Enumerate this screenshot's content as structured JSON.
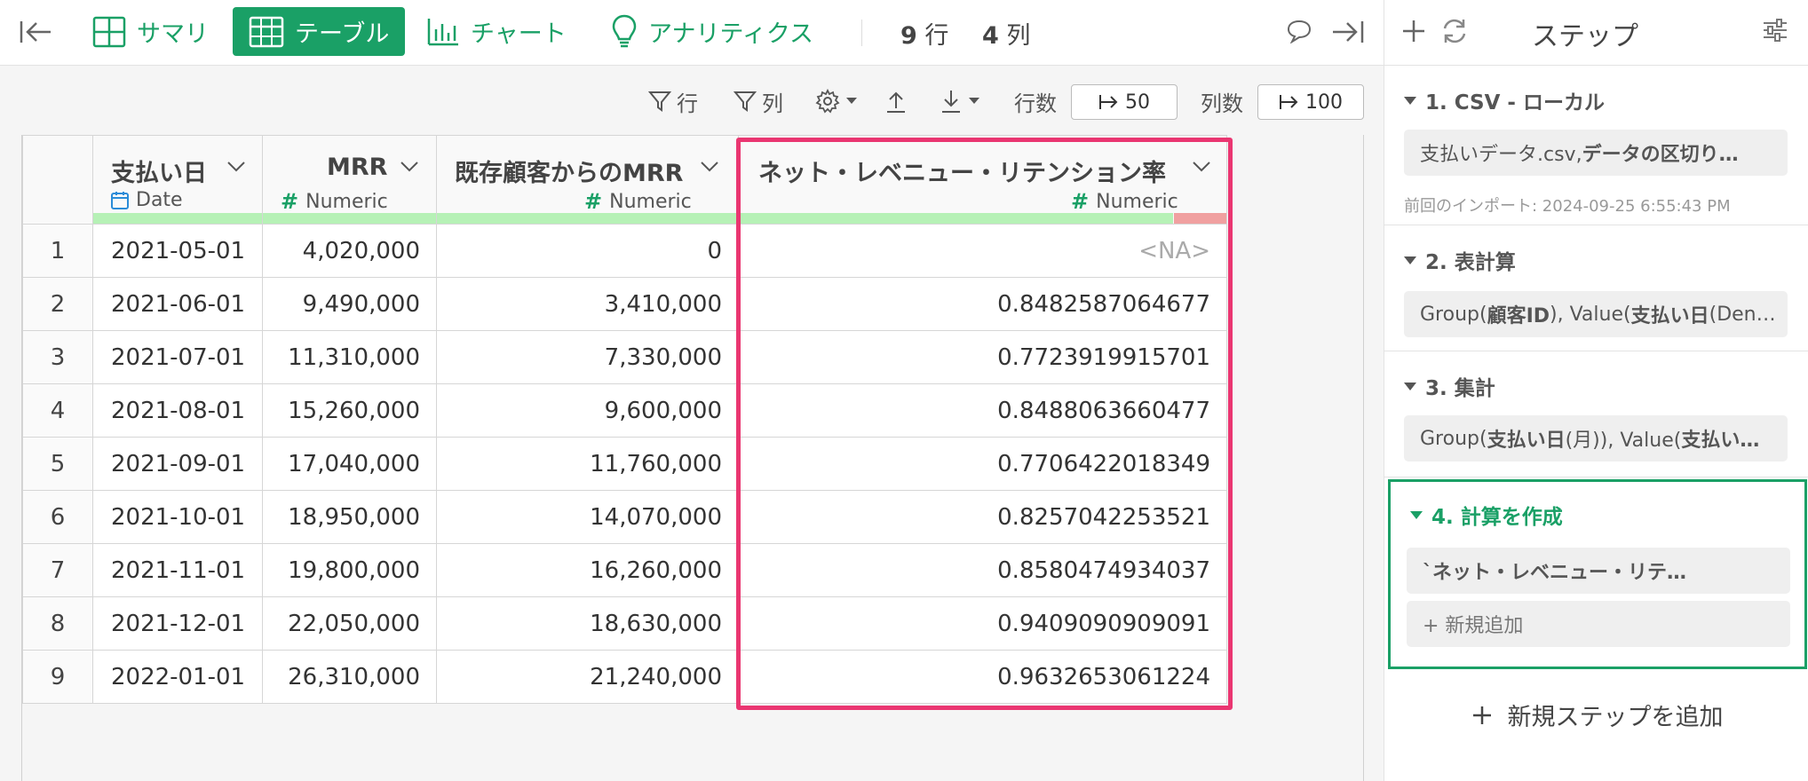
{
  "topbar": {
    "tabs": [
      {
        "label": "サマリ",
        "icon": "summary-grid-icon",
        "active": false
      },
      {
        "label": "テーブル",
        "icon": "table-icon",
        "active": true
      },
      {
        "label": "チャート",
        "icon": "bar-chart-icon",
        "active": false
      },
      {
        "label": "アナリティクス",
        "icon": "lightbulb-icon",
        "active": false
      }
    ],
    "rows_count": "9",
    "rows_unit": "行",
    "cols_count": "4",
    "cols_unit": "列"
  },
  "toolbar": {
    "row_filter": "行",
    "col_filter": "列",
    "row_count_label": "行数",
    "row_count_value": "50",
    "col_count_label": "列数",
    "col_count_value": "100"
  },
  "table": {
    "columns": [
      {
        "name": "支払い日",
        "type": "Date"
      },
      {
        "name": "MRR",
        "type": "Numeric"
      },
      {
        "name": "既存顧客からのMRR",
        "type": "Numeric"
      },
      {
        "name": "ネット・レベニュー・リテンション率",
        "type": "Numeric"
      }
    ],
    "rows": [
      {
        "n": "1",
        "date": "2021-05-01",
        "mrr": "4,020,000",
        "existing": "0",
        "nrr": "<NA>"
      },
      {
        "n": "2",
        "date": "2021-06-01",
        "mrr": "9,490,000",
        "existing": "3,410,000",
        "nrr": "0.8482587064677"
      },
      {
        "n": "3",
        "date": "2021-07-01",
        "mrr": "11,310,000",
        "existing": "7,330,000",
        "nrr": "0.7723919915701"
      },
      {
        "n": "4",
        "date": "2021-08-01",
        "mrr": "15,260,000",
        "existing": "9,600,000",
        "nrr": "0.8488063660477"
      },
      {
        "n": "5",
        "date": "2021-09-01",
        "mrr": "17,040,000",
        "existing": "11,760,000",
        "nrr": "0.7706422018349"
      },
      {
        "n": "6",
        "date": "2021-10-01",
        "mrr": "18,950,000",
        "existing": "14,070,000",
        "nrr": "0.8257042253521"
      },
      {
        "n": "7",
        "date": "2021-11-01",
        "mrr": "19,800,000",
        "existing": "16,260,000",
        "nrr": "0.8580474934037"
      },
      {
        "n": "8",
        "date": "2021-12-01",
        "mrr": "22,050,000",
        "existing": "18,630,000",
        "nrr": "0.9409090909091"
      },
      {
        "n": "9",
        "date": "2022-01-01",
        "mrr": "26,310,000",
        "existing": "21,240,000",
        "nrr": "0.9632653061224"
      }
    ]
  },
  "panel": {
    "title": "ステップ",
    "steps": [
      {
        "title": "1. CSV - ローカル",
        "body_plain": "支払いデータ.csv, ",
        "body_bold": "データの区切り…",
        "meta": "前回のインポート: 2024-09-25 6:55:43 PM"
      },
      {
        "title": "2. 表計算",
        "body_pre": "Group(",
        "body_b1": "顧客ID",
        "body_mid": "), Value(",
        "body_b2": "支払い日",
        "body_post": " (Den…"
      },
      {
        "title": "3. 集計",
        "body_pre": "Group(",
        "body_b1": "支払い日",
        "body_mid": " (月)), Value(",
        "body_b2": "支払い…"
      },
      {
        "title": "4. 計算を作成",
        "body": "`ネット・レベニュー・リテ…",
        "add_label": "+ 新規追加"
      }
    ],
    "add_step": "新規ステップを追加"
  },
  "colors": {
    "accent": "#1aa066",
    "highlight": "#ea3671",
    "quality_ok": "#b6f1b6",
    "quality_na": "#f0a0a0"
  }
}
